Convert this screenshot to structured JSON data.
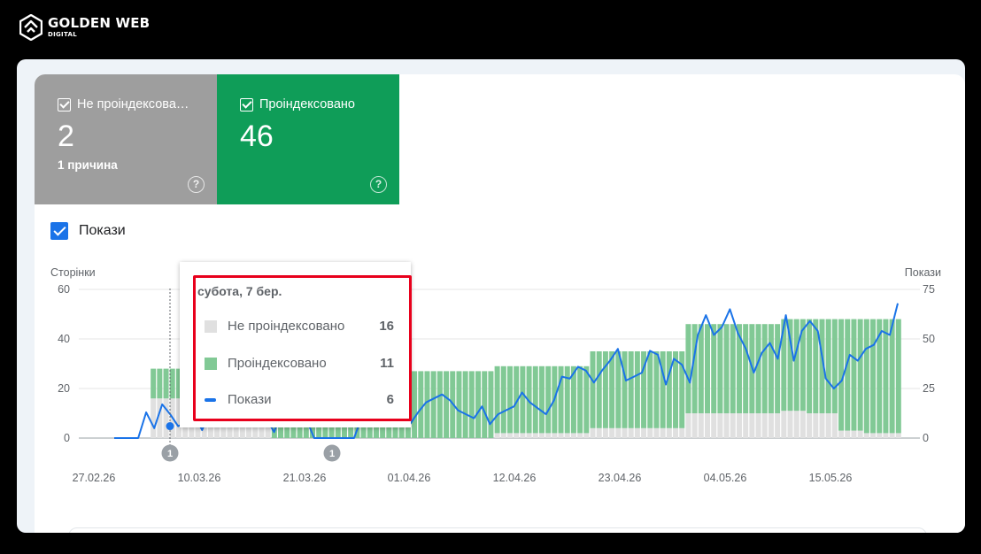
{
  "brand": {
    "name": "GOLDEN WEB",
    "sub": "DIGITAL"
  },
  "cards": [
    {
      "title": "Не проіндексова…",
      "value": "2",
      "reason": "1 причина",
      "color": "#9e9e9e"
    },
    {
      "title": "Проіндексовано",
      "value": "46",
      "color": "#0f9d58"
    }
  ],
  "impressions_toggle": {
    "label": "Покази",
    "checked": true
  },
  "chart_data": {
    "type": "bar",
    "y_left_label": "Сторінки",
    "y_right_label": "Покази",
    "y_left_ticks": [
      "60",
      "40",
      "20",
      "0"
    ],
    "y_right_ticks": [
      "75",
      "50",
      "25",
      "0"
    ],
    "ylim_left": [
      0,
      60
    ],
    "ylim_right": [
      0,
      75
    ],
    "x_tick_labels": [
      "27.02.26",
      "10.03.26",
      "21.03.26",
      "01.04.26",
      "12.04.26",
      "23.04.26",
      "04.05.26",
      "15.05.26"
    ],
    "annotations": [
      "1",
      "1"
    ],
    "series": [
      {
        "name": "Не проіндексовано",
        "color": "#e0e0e0",
        "values": [
          0,
          0,
          0,
          0,
          0,
          0,
          16,
          16,
          16,
          16,
          16,
          16,
          16,
          16,
          16,
          16,
          16,
          16,
          16,
          16,
          16,
          16,
          16,
          16,
          16,
          0,
          0,
          0,
          0,
          0,
          0,
          0,
          0,
          0,
          0,
          0,
          0,
          0,
          0,
          0,
          0,
          0,
          0,
          0,
          0,
          0,
          0,
          0,
          0,
          0,
          0,
          0,
          0,
          0,
          0,
          0,
          0,
          0,
          0,
          0,
          2,
          2,
          2,
          2,
          2,
          2,
          2,
          2,
          2,
          2,
          2,
          2,
          2,
          2,
          2,
          4,
          4,
          4,
          4,
          4,
          4,
          4,
          4,
          4,
          4,
          4,
          4,
          4,
          4,
          4,
          10,
          10,
          10,
          10,
          10,
          10,
          10,
          10,
          10,
          10,
          10,
          10,
          10,
          10,
          10,
          11,
          11,
          11,
          11,
          10,
          10,
          10,
          10,
          10,
          3,
          3,
          3,
          3,
          2,
          2,
          2,
          2,
          2,
          2
        ]
      },
      {
        "name": "Проіндексовано",
        "color": "#81c995",
        "values": [
          0,
          0,
          0,
          0,
          0,
          0,
          12,
          12,
          12,
          12,
          12,
          12,
          12,
          12,
          12,
          12,
          12,
          12,
          12,
          12,
          12,
          12,
          12,
          12,
          12,
          27,
          27,
          27,
          27,
          27,
          27,
          27,
          27,
          27,
          27,
          27,
          27,
          27,
          27,
          27,
          27,
          27,
          27,
          27,
          27,
          27,
          27,
          27,
          27,
          27,
          27,
          27,
          27,
          27,
          27,
          27,
          27,
          27,
          27,
          27,
          27,
          27,
          27,
          27,
          27,
          27,
          27,
          27,
          27,
          27,
          27,
          27,
          27,
          27,
          27,
          31,
          31,
          31,
          31,
          31,
          31,
          31,
          31,
          31,
          31,
          31,
          31,
          31,
          31,
          31,
          36,
          36,
          36,
          36,
          36,
          36,
          36,
          36,
          36,
          36,
          36,
          36,
          36,
          36,
          36,
          37,
          37,
          37,
          37,
          38,
          38,
          38,
          38,
          38,
          45,
          45,
          45,
          45,
          46,
          46,
          46,
          46,
          46,
          46
        ]
      },
      {
        "name": "Покази",
        "color": "#1a73e8",
        "values": [
          0,
          0,
          0,
          0,
          13,
          5,
          17,
          12,
          6,
          8,
          12,
          4,
          14,
          6,
          8,
          10,
          34,
          6,
          18,
          10,
          3,
          14,
          7,
          19,
          10,
          0,
          0,
          0,
          0,
          0,
          0,
          11,
          14,
          8,
          12,
          16,
          10,
          7,
          13,
          18,
          20,
          22,
          19,
          14,
          12,
          10,
          16,
          7,
          12,
          14,
          16,
          23,
          18,
          15,
          12,
          19,
          31,
          30,
          36,
          34,
          28,
          34,
          39,
          45,
          29,
          31,
          33,
          44,
          42,
          27,
          40,
          37,
          28,
          52,
          62,
          52,
          56,
          65,
          53,
          45,
          33,
          43,
          48,
          40,
          62,
          39,
          54,
          59,
          54,
          30,
          25,
          29,
          42,
          39,
          45,
          47,
          54,
          52,
          68
        ]
      }
    ]
  },
  "tooltip": {
    "date": "субота, 7 бер.",
    "rows": [
      {
        "label": "Не проіндексовано",
        "value": "16",
        "color": "#e0e0e0"
      },
      {
        "label": "Проіндексовано",
        "value": "11",
        "color": "#81c995"
      },
      {
        "label": "Покази",
        "value": "6",
        "color": "#1a73e8"
      }
    ]
  }
}
